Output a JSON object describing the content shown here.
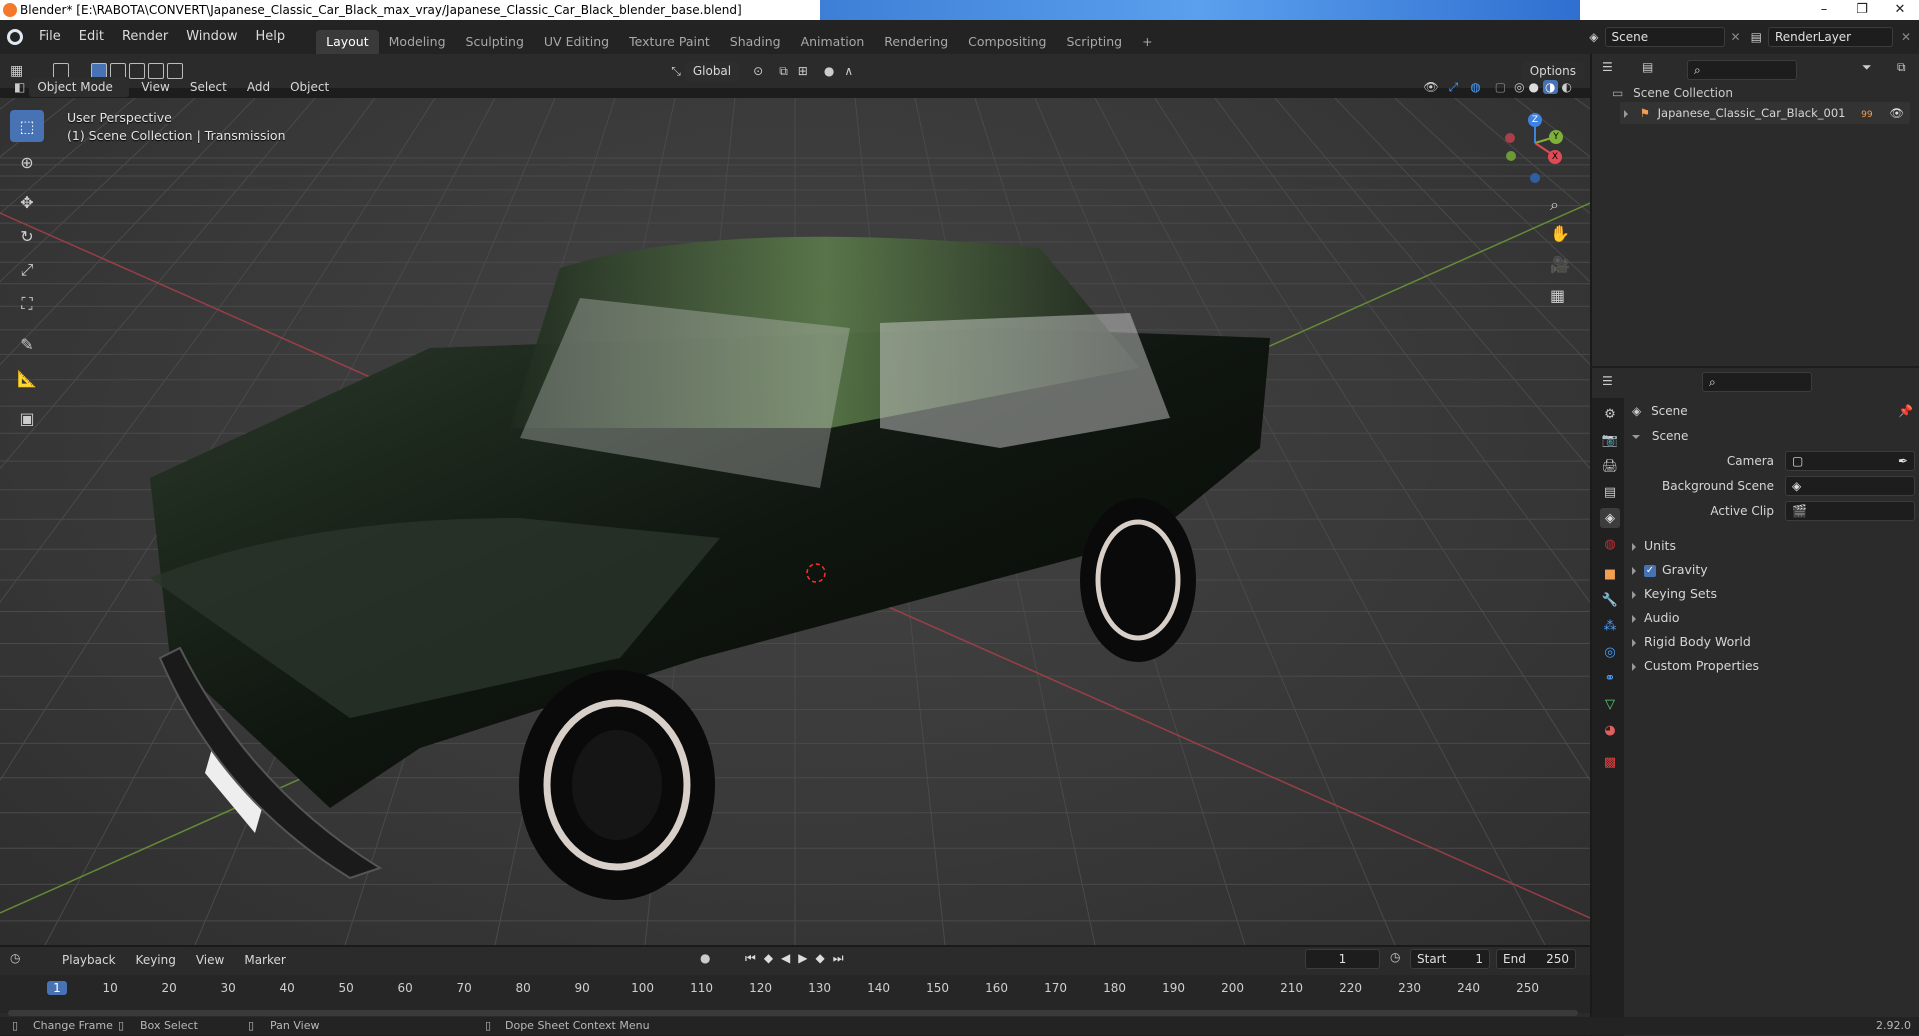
{
  "window": {
    "title": "Blender* [E:\\RABOTA\\CONVERT\\Japanese_Classic_Car_Black_max_vray/Japanese_Classic_Car_Black_blender_base.blend]",
    "controls": [
      "–",
      "❐",
      "✕"
    ]
  },
  "menus": [
    "File",
    "Edit",
    "Render",
    "Window",
    "Help"
  ],
  "workspaces": {
    "tabs": [
      "Layout",
      "Modeling",
      "Sculpting",
      "UV Editing",
      "Texture Paint",
      "Shading",
      "Animation",
      "Rendering",
      "Compositing",
      "Scripting"
    ],
    "active": "Layout",
    "add": "+"
  },
  "scene_selector": "Scene",
  "layer_selector": "RenderLayer",
  "viewport_header": {
    "mode": "Object Mode",
    "menus": [
      "View",
      "Select",
      "Add",
      "Object"
    ],
    "transform_orientation": "Global",
    "options": "Options"
  },
  "viewport": {
    "view_name": "User Perspective",
    "collection_info": "(1) Scene Collection | Transmission",
    "gizmo_axes": [
      "Z",
      "Y",
      "X"
    ]
  },
  "outliner": {
    "root": "Scene Collection",
    "items": [
      {
        "name": "Japanese_Classic_Car_Black_001",
        "badge": "99"
      }
    ]
  },
  "properties": {
    "context": "Scene",
    "panel_title": "Scene",
    "fields": [
      {
        "label": "Camera",
        "value": ""
      },
      {
        "label": "Background Scene",
        "value": ""
      },
      {
        "label": "Active Clip",
        "value": ""
      }
    ],
    "subpanels": [
      {
        "label": "Units",
        "checkbox": false
      },
      {
        "label": "Gravity",
        "checkbox": true
      },
      {
        "label": "Keying Sets",
        "checkbox": false
      },
      {
        "label": "Audio",
        "checkbox": false
      },
      {
        "label": "Rigid Body World",
        "checkbox": false
      },
      {
        "label": "Custom Properties",
        "checkbox": false
      }
    ]
  },
  "timeline": {
    "menus": [
      "Playback",
      "Keying",
      "View",
      "Marker"
    ],
    "current_frame": "1",
    "start_label": "Start",
    "start": "1",
    "end_label": "End",
    "end": "250",
    "ticks": [
      "1",
      "10",
      "20",
      "30",
      "40",
      "50",
      "60",
      "70",
      "80",
      "90",
      "100",
      "110",
      "120",
      "130",
      "140",
      "150",
      "160",
      "170",
      "180",
      "190",
      "200",
      "210",
      "220",
      "230",
      "240",
      "250"
    ]
  },
  "statusbar": {
    "hints": [
      "Change Frame",
      "Box Select",
      "Pan View",
      "Dope Sheet Context Menu"
    ],
    "version": "2.92.0"
  },
  "colors": {
    "accent": "#4772b3",
    "x_axis": "#e04a55",
    "y_axis": "#7fb03a",
    "z_axis": "#3f82e0",
    "car_body": "#101510"
  }
}
